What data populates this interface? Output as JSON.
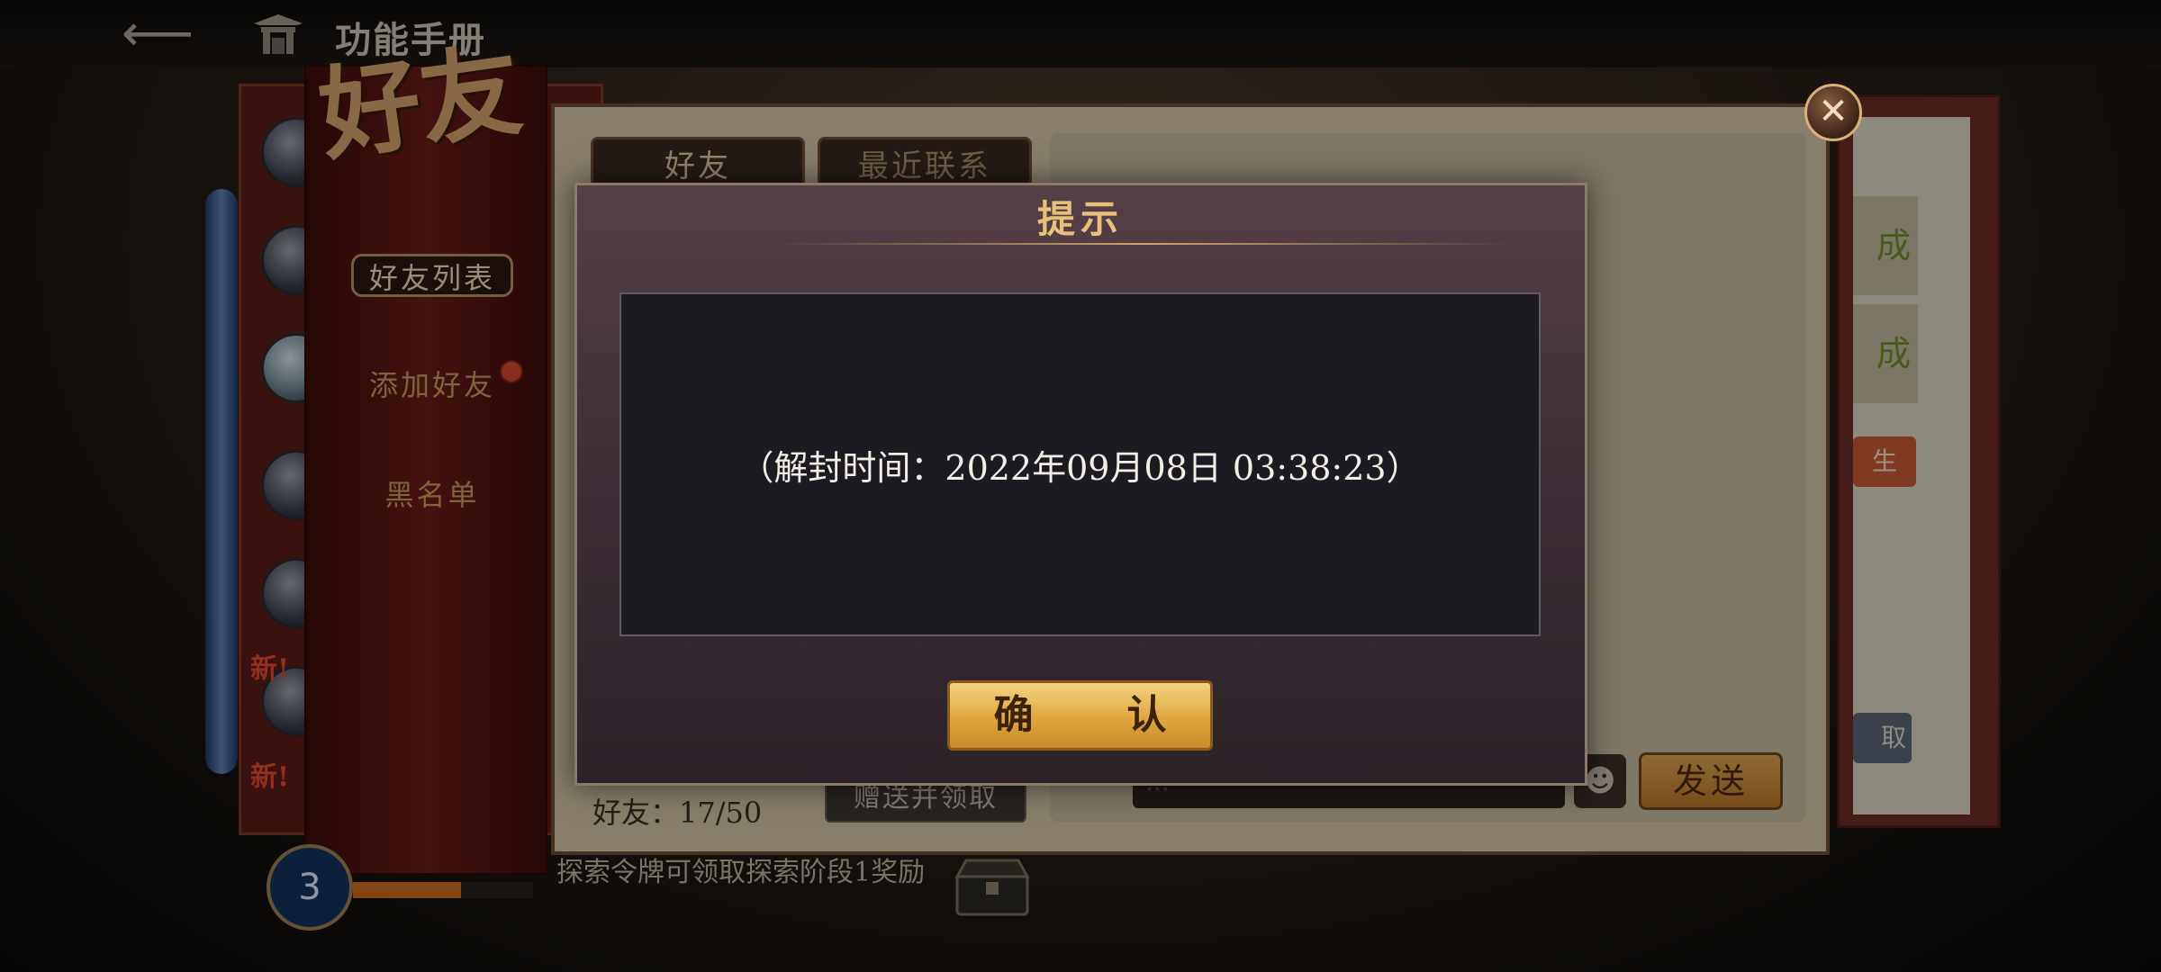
{
  "header": {
    "back_icon": "back-arrow-icon",
    "home_icon": "gate-icon",
    "title": "功能手册"
  },
  "hall": {
    "title": "好友",
    "tabs": [
      {
        "label": "好友列表",
        "active": true
      },
      {
        "label": "添加好友",
        "active": false,
        "badge": "red-dot"
      },
      {
        "label": "黑名单",
        "active": false
      }
    ]
  },
  "strip": {
    "new_tags": [
      "新!",
      "新!"
    ]
  },
  "panel": {
    "tabs": [
      {
        "label": "好友"
      },
      {
        "label": "最近联系"
      }
    ],
    "friend_count": "好友：17/50",
    "gift_button": "赠送并领取",
    "send_button": "发送",
    "right_items": [
      "成",
      "成"
    ],
    "right_red": "生",
    "right_grey": "取",
    "chat_placeholder": "..."
  },
  "bottom": {
    "level": "3",
    "progress": 0.6,
    "tip": "探索令牌可领取探索阶段1奖励"
  },
  "dialog": {
    "title": "提示",
    "message": "（解封时间：2022年09月08日 03:38:23）",
    "confirm": "确　认"
  },
  "colors": {
    "accent_gold": "#e9c07a",
    "button_gold": "#e0a63e",
    "badge_red": "#d2472e"
  }
}
